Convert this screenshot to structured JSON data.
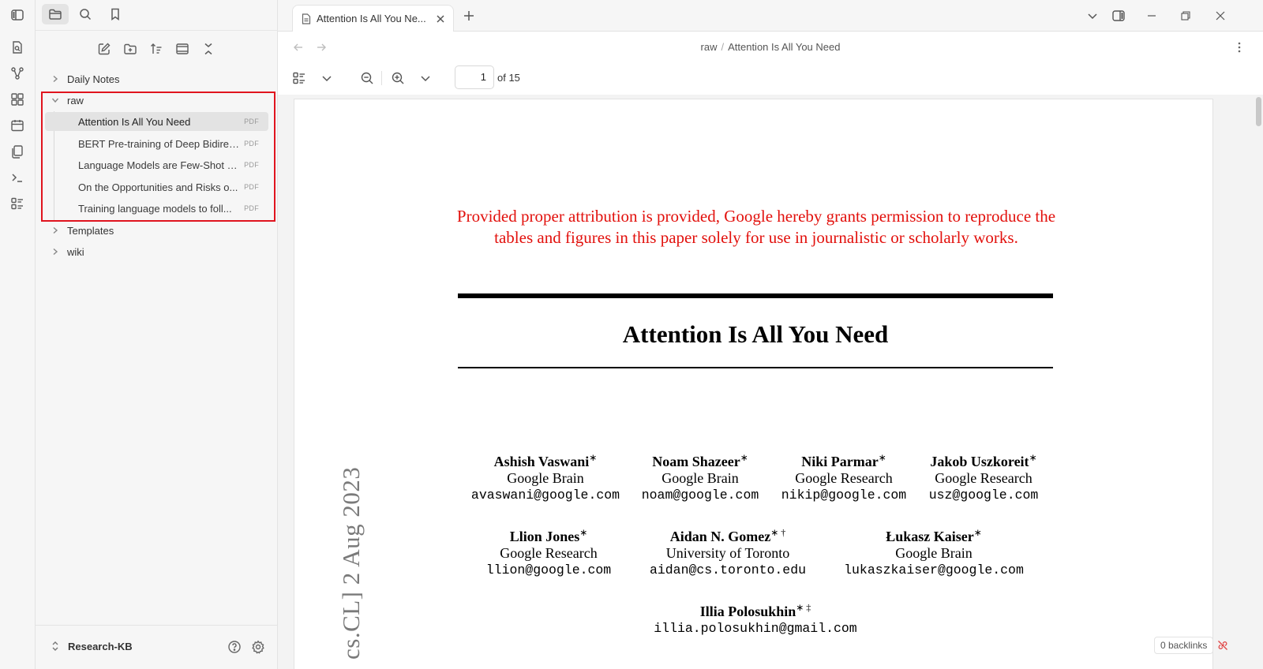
{
  "ribbon": {
    "icons": [
      "toggle-sidebar-icon",
      "search-in-file-icon",
      "graph-view-icon",
      "canvas-icon",
      "daily-note-icon",
      "templates-icon",
      "command-palette-icon",
      "bases-icon"
    ]
  },
  "sidebar": {
    "top_tabs": [
      "file-explorer",
      "search",
      "bookmarks"
    ],
    "actions": [
      "new-note",
      "new-folder",
      "change-sort-order",
      "auto-reveal-current-file",
      "collapse-all"
    ],
    "tree": {
      "daily_notes": "Daily Notes",
      "raw": "raw",
      "files": [
        {
          "name": "Attention Is All You Need",
          "badge": "PDF"
        },
        {
          "name": "BERT Pre-training of Deep Bidirec...",
          "badge": "PDF"
        },
        {
          "name": "Language Models are Few-Shot L...",
          "badge": "PDF"
        },
        {
          "name": "On the Opportunities and Risks o...",
          "badge": "PDF"
        },
        {
          "name": "Training language models to foll...",
          "badge": "PDF"
        }
      ],
      "templates": "Templates",
      "wiki": "wiki"
    },
    "vault": {
      "name": "Research-KB"
    }
  },
  "tabs": [
    {
      "title": "Attention Is All You Ne..."
    }
  ],
  "header": {
    "breadcrumb": [
      "raw",
      "Attention Is All You Need"
    ],
    "separator": "/"
  },
  "pdf_toolbar": {
    "page_current": "1",
    "page_total": "of 15"
  },
  "pdf": {
    "notice": "Provided proper attribution is provided, Google hereby grants permission to reproduce the tables and figures in this paper solely for use in journalistic or scholarly works.",
    "title": "Attention Is All You Need",
    "arxiv_stamp": "cs.CL]  2 Aug 2023",
    "authors": [
      {
        "name": "Ashish Vaswani",
        "mark": "∗",
        "affiliation": "Google Brain",
        "email": "avaswani@google.com"
      },
      {
        "name": "Noam Shazeer",
        "mark": "∗",
        "affiliation": "Google Brain",
        "email": "noam@google.com"
      },
      {
        "name": "Niki Parmar",
        "mark": "∗",
        "affiliation": "Google Research",
        "email": "nikip@google.com"
      },
      {
        "name": "Jakob Uszkoreit",
        "mark": "∗",
        "affiliation": "Google Research",
        "email": "usz@google.com"
      },
      {
        "name": "Llion Jones",
        "mark": "∗",
        "affiliation": "Google Research",
        "email": "llion@google.com"
      },
      {
        "name": "Aidan N. Gomez",
        "mark": "∗ †",
        "affiliation": "University of Toronto",
        "email": "aidan@cs.toronto.edu"
      },
      {
        "name": "Łukasz Kaiser",
        "mark": "∗",
        "affiliation": "Google Brain",
        "email": "lukaszkaiser@google.com"
      },
      {
        "name": "Illia Polosukhin",
        "mark": "∗ ‡",
        "affiliation": "",
        "email": "illia.polosukhin@gmail.com"
      }
    ]
  },
  "status": {
    "backlinks": "0 backlinks"
  },
  "colors": {
    "highlight_box": "#e0141e",
    "notice_red": "#e2100c"
  }
}
